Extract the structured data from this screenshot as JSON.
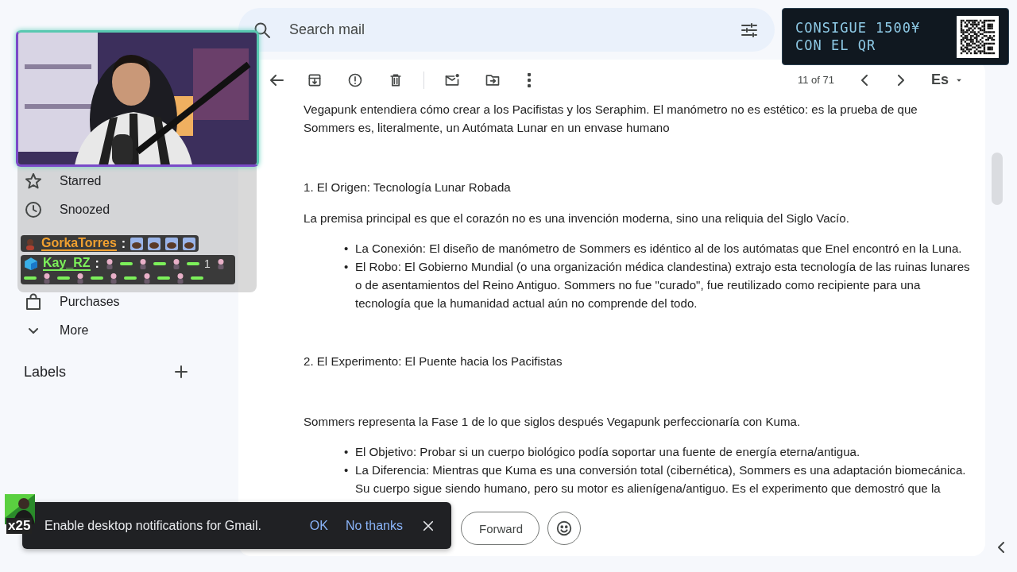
{
  "search": {
    "placeholder": "Search mail"
  },
  "promo": {
    "lines": [
      "CONSIGUE 1500¥",
      "CON EL QR"
    ]
  },
  "sidebar": {
    "items": [
      {
        "label": "Starred"
      },
      {
        "label": "Snoozed"
      },
      {
        "label": "Purchases"
      },
      {
        "label": "More"
      }
    ],
    "labels_heading": "Labels"
  },
  "chat": {
    "messages": [
      {
        "user": "GorkaTorres",
        "color": "#f0a030",
        "separator": ":",
        "parts": [
          {
            "kind": "emote"
          },
          {
            "kind": "emote"
          },
          {
            "kind": "emote"
          },
          {
            "kind": "emote"
          }
        ]
      },
      {
        "user": "Kay_RZ",
        "color": "#7cf05a",
        "separator": ":",
        "parts": [
          {
            "kind": "emote"
          },
          {
            "kind": "dash"
          },
          {
            "kind": "emote"
          },
          {
            "kind": "dash"
          },
          {
            "kind": "emote"
          },
          {
            "kind": "dash"
          },
          {
            "kind": "text",
            "text": "1"
          },
          {
            "kind": "emote"
          },
          {
            "kind": "dash"
          },
          {
            "kind": "emote"
          },
          {
            "kind": "dash"
          },
          {
            "kind": "emote"
          },
          {
            "kind": "dash"
          },
          {
            "kind": "emote"
          },
          {
            "kind": "dash"
          },
          {
            "kind": "emote"
          },
          {
            "kind": "dash"
          },
          {
            "kind": "emote"
          },
          {
            "kind": "dash"
          }
        ]
      }
    ]
  },
  "toolbar": {
    "position": "11 of 71",
    "language": "Es"
  },
  "message": {
    "blocks": [
      {
        "kind": "paragraph",
        "text": "Vegapunk entendiera cómo crear a los Pacifistas y los Seraphim. El manómetro no es estético: es la prueba de que Sommers es, literalmente, un Autómata Lunar en un envase humano"
      },
      {
        "kind": "heading",
        "text": "1. El Origen: Tecnología Lunar Robada"
      },
      {
        "kind": "paragraph",
        "text": "La premisa principal es que el corazón no es una invención moderna, sino una reliquia del Siglo Vacío."
      },
      {
        "kind": "list",
        "marker": "•",
        "items": [
          "La Conexión: El diseño de manómetro de Sommers es idéntico al de los autómatas que Enel encontró en la Luna.",
          "El Robo: El Gobierno Mundial (o una organización médica clandestina) extrajo esta tecnología de las ruinas lunares o de asentamientos del Reino Antiguo. Sommers no fue \"curado\", fue reutilizado como recipiente para una tecnología que la humanidad actual aún no comprende del todo."
        ]
      },
      {
        "kind": "heading",
        "text": "2. El Experimento: El Puente hacia los Pacifistas"
      },
      {
        "kind": "paragraph",
        "text": "Sommers representa la Fase 1 de lo que siglos después Vegapunk perfeccionaría con Kuma."
      },
      {
        "kind": "list",
        "marker": "•",
        "items": [
          "El Objetivo: Probar si un cuerpo biológico podía soportar una fuente de energía eterna/antigua.",
          "La Diferencia: Mientras que Kuma es una conversión total (cibernética), Sommers es una adaptación biomecánica. Su cuerpo sigue siendo humano, pero su motor es alienígena/antiguo. Es el experimento que demostró que la"
        ]
      }
    ]
  },
  "reply": {
    "forward": "Forward"
  },
  "snackbar": {
    "text": "Enable desktop notifications for Gmail.",
    "actions": [
      "OK",
      "No thanks"
    ]
  },
  "combo": {
    "count": "x25"
  }
}
